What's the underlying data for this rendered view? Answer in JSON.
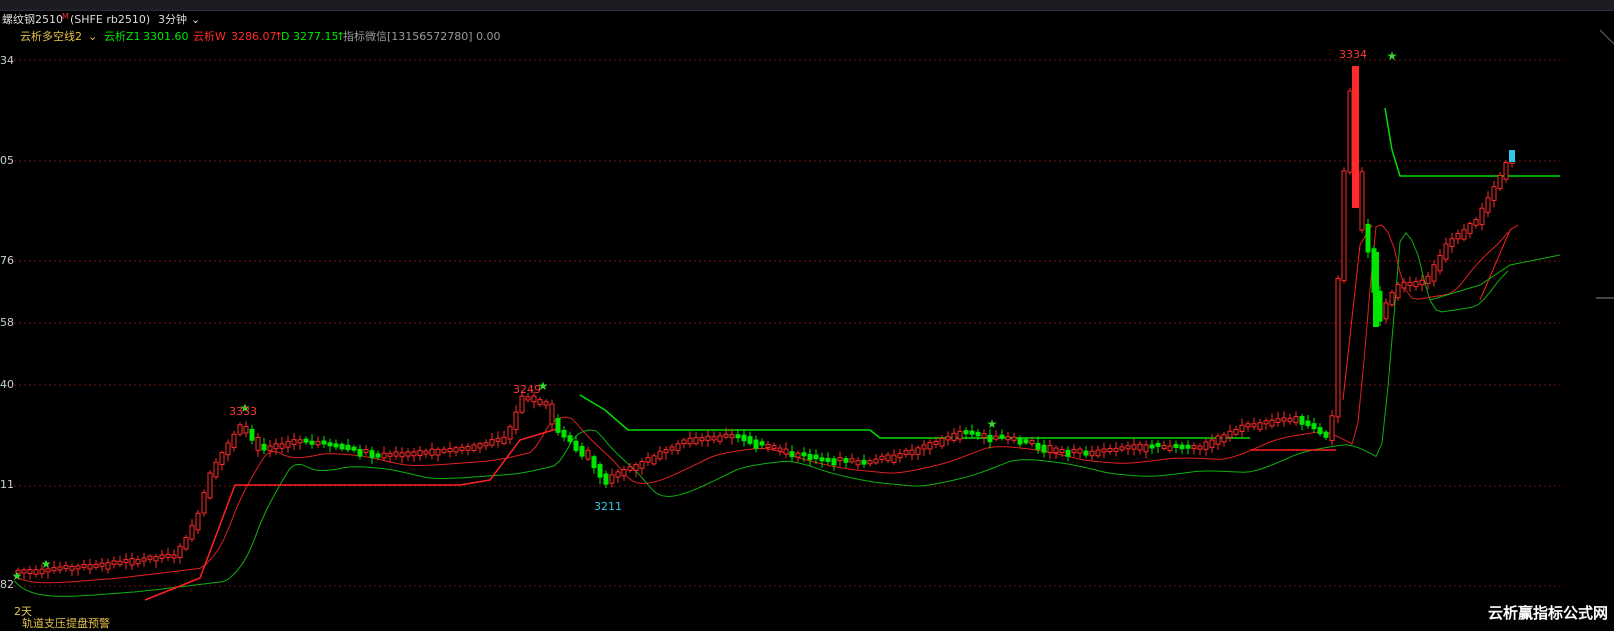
{
  "title": {
    "instrument": "螺纹钢2510",
    "marker": "M",
    "code": "(SHFE rb2510)",
    "period": "3分钟"
  },
  "legend": {
    "indicator_name": "云析多空线2",
    "z1_label": "云析Z1",
    "z1_value": "3301.60",
    "w_label": "云析W",
    "w_value": "3286.07",
    "d_label": "D",
    "d_value": "3277.15",
    "wechat": "指标微信[13156572780] 0.00"
  },
  "y_axis_labels": [
    "34",
    "05",
    "76",
    "58",
    "40",
    "11",
    "82"
  ],
  "annotations": {
    "peak1": "3333",
    "peak2": "3249",
    "low1": "3211",
    "peak3": "3334"
  },
  "footer_text": "2天",
  "footer_text2": "轨道支压提盘预警",
  "watermark": "云析赢指标公式网",
  "colors": {
    "up": "#ff2a2a",
    "down": "#00e600",
    "resistance": "#00dd00",
    "support": "#ff2020",
    "grid": "#7a0f0f"
  }
}
